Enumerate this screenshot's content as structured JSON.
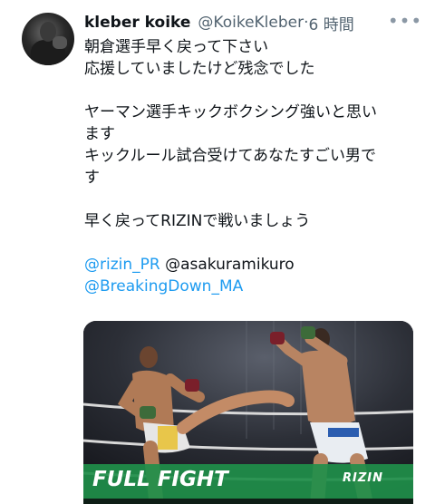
{
  "tweet": {
    "author": "kleber koike",
    "handle": "@KoikeKleber",
    "separator": "·",
    "time": "6 時間",
    "more_icon": "more-dots-icon",
    "lines": [
      "朝倉選手早く戻って下さい",
      "応援していましたけど残念でした",
      "",
      "ヤーマン選手キックボクシング強いと思い",
      "ます",
      "キックルール試合受けてあなたすごい男で",
      "す",
      "",
      "早く戻ってRIZINで戦いましょう",
      ""
    ],
    "mentions": {
      "rizin_pr": "@rizin_PR",
      "asakura": "@asakuramikuro",
      "breakingdown": "@BreakingDown_MA"
    },
    "media": {
      "caption": "FULL FIGHT",
      "logo": "RIZIN"
    }
  },
  "colors": {
    "link": "#1d9bf0",
    "muted": "#536471",
    "text": "#0f1419",
    "banner": "#1f8f4a"
  }
}
